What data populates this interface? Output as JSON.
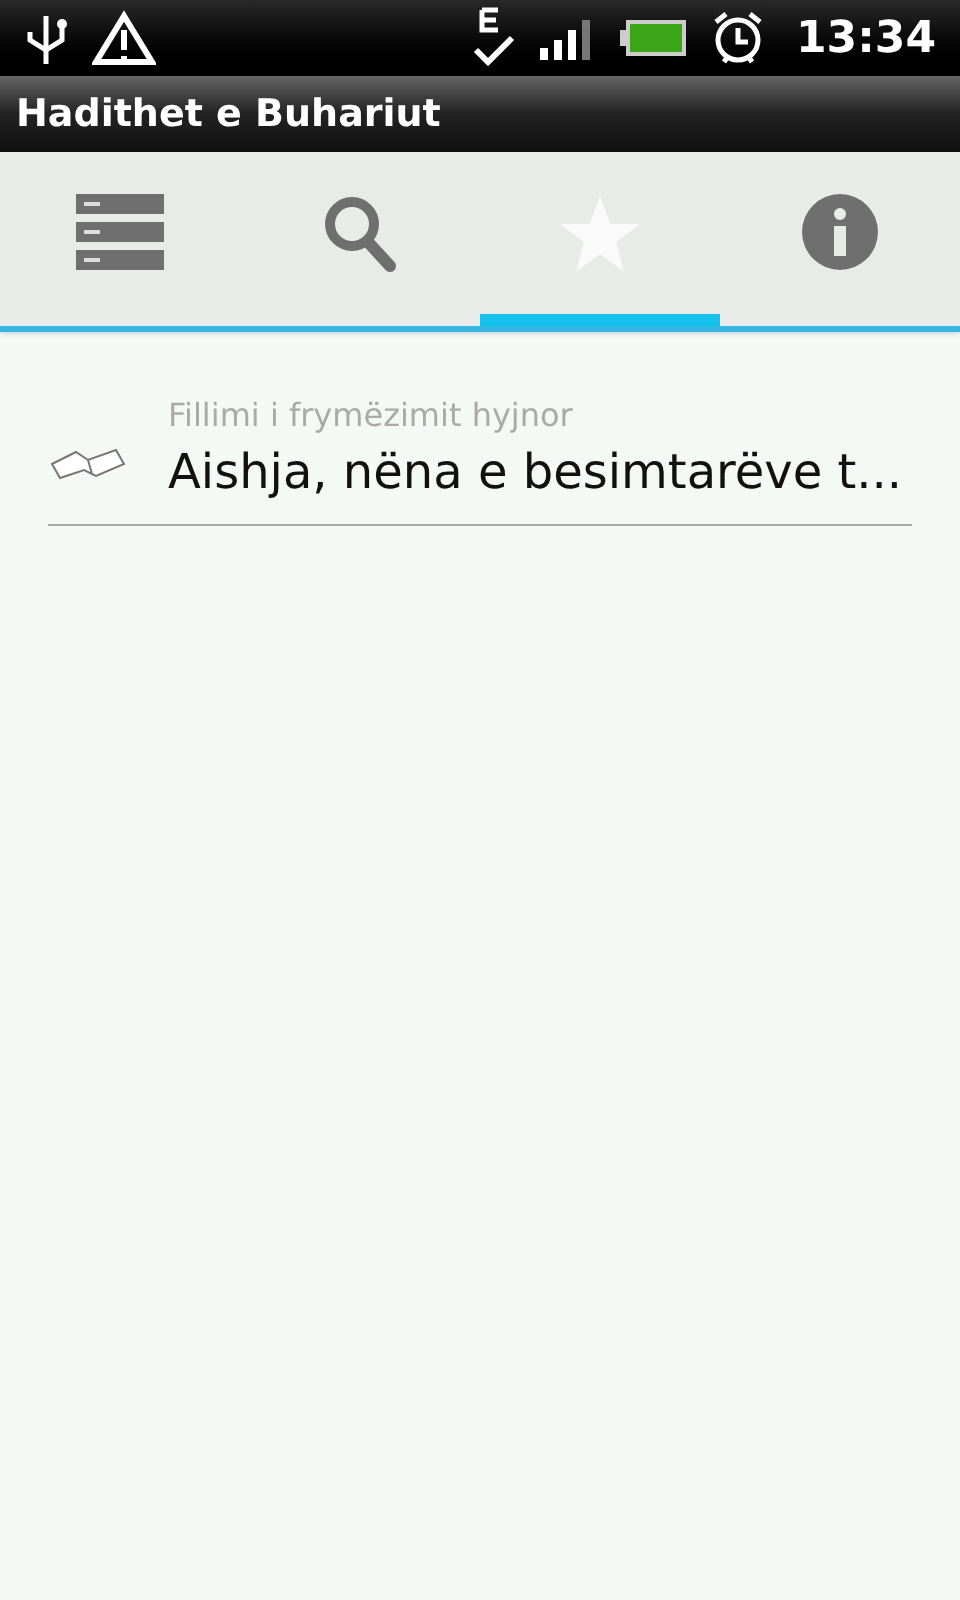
{
  "status_bar": {
    "time": "13:34"
  },
  "window": {
    "title": "Hadithet e Buhariut"
  },
  "tabs": [
    {
      "kind": "list",
      "selected": false
    },
    {
      "kind": "search",
      "selected": false
    },
    {
      "kind": "star",
      "selected": true
    },
    {
      "kind": "info",
      "selected": false
    }
  ],
  "items": [
    {
      "chapter": "Fillimi i frymëzimit hyjnor",
      "title": "Aishja, nëna e besimtarëve t..."
    }
  ]
}
